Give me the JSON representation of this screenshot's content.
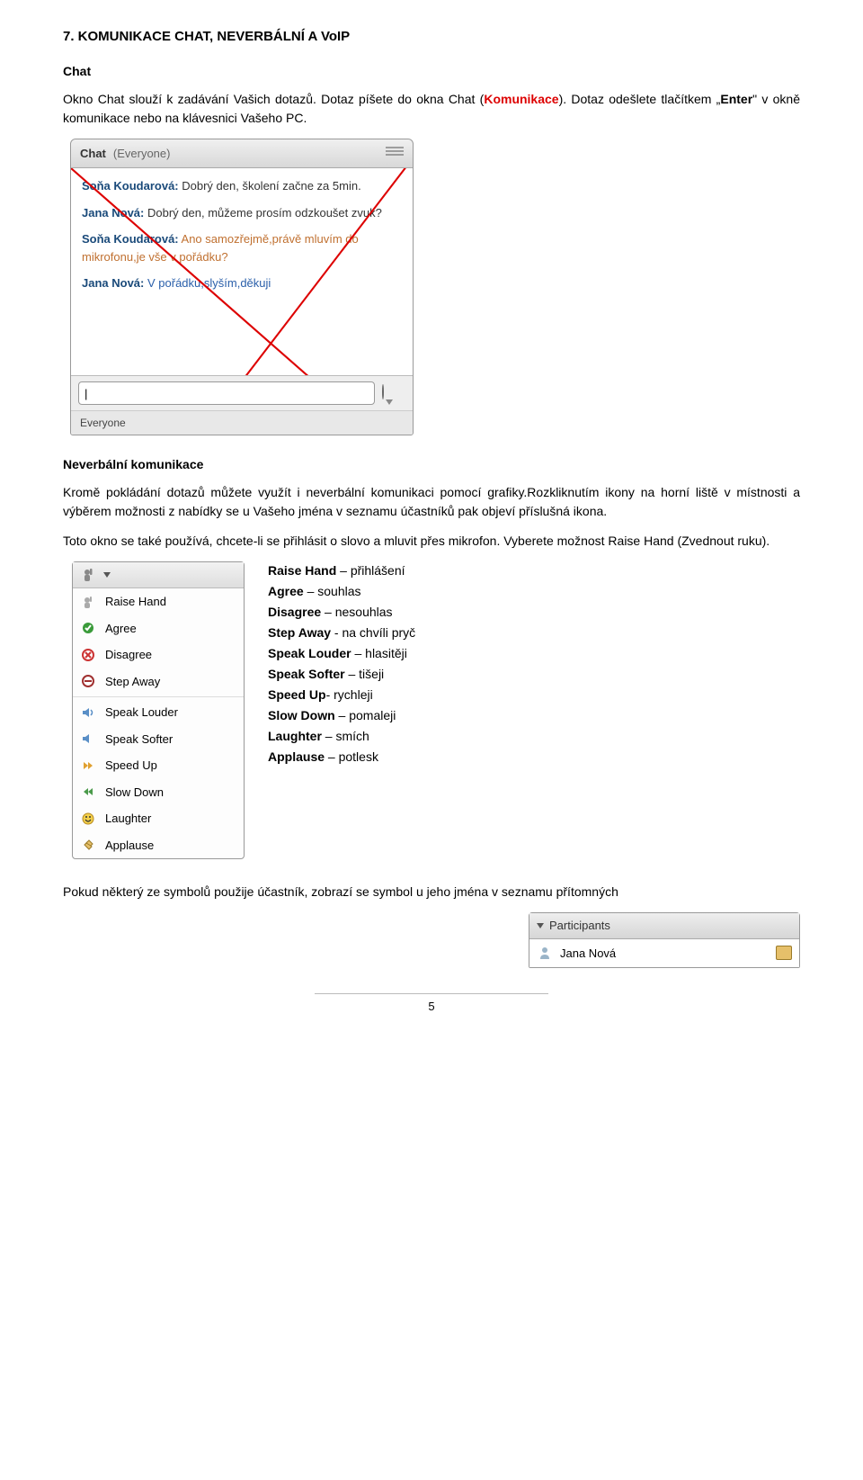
{
  "title": "7.   KOMUNIKACE CHAT, NEVERBÁLNÍ A VoIP",
  "sec1": {
    "heading": "Chat",
    "para1_a": "Okno Chat slouží k zadávání Vašich dotazů. Dotaz píšete do okna Chat (",
    "para1_red": "Komunikace",
    "para1_b": "). Dotaz odešlete tlačítkem „",
    "para1_enter": "Enter",
    "para1_c": "\" v okně komunikace nebo na klávesnici Vašeho PC."
  },
  "chat": {
    "title": "Chat",
    "scope": "(Everyone)",
    "messages": [
      {
        "author": "Soňa Koudarová:",
        "text": "Dobrý den, školení začne za 5min."
      },
      {
        "author": "Jana Nová:",
        "text": "Dobrý den, můžeme prosím odzkoušet zvuk?"
      },
      {
        "author": "Soňa Koudarová:",
        "text": "Ano samozřejmě,právě mluvím do mikrofonu,je vše v pořádku?"
      },
      {
        "author": "Jana Nová:",
        "text": "V pořádku,slyším,děkuji"
      }
    ],
    "input_value": "|",
    "footer": "Everyone"
  },
  "sec2": {
    "heading": "Neverbální komunikace",
    "para1": "Kromě pokládání dotazů můžete využít i neverbální komunikaci pomocí grafiky.Rozkliknutím ikony na horní liště v místnosti  a výběrem možnosti z nabídky se u Vašeho jména v seznamu účastníků pak objeví příslušná ikona.",
    "para2": "Toto okno se také používá, chcete-li se přihlásit o slovo a mluvit přes mikrofon. Vyberete možnost Raise Hand (Zvednout ruku)."
  },
  "rh_menu": {
    "items": [
      "Raise Hand",
      "Agree",
      "Disagree",
      "Step Away",
      "Speak Louder",
      "Speak Softer",
      "Speed Up",
      "Slow Down",
      "Laughter",
      "Applause"
    ]
  },
  "rh_defs": [
    {
      "term": "Raise Hand",
      "def": " – přihlášení"
    },
    {
      "term": "Agree",
      "def": " – souhlas"
    },
    {
      "term": "Disagree",
      "def": " – nesouhlas"
    },
    {
      "term": "Step Away",
      "def": " -  na chvíli pryč"
    },
    {
      "term": "Speak Louder",
      "def": " – hlasitěji"
    },
    {
      "term": "Speak Softer",
      "def": " – tišeji"
    },
    {
      "term": "Speed Up",
      "def": "- rychleji"
    },
    {
      "term": "Slow Down",
      "def": " – pomaleji"
    },
    {
      "term": "Laughter",
      "def": " – smích"
    },
    {
      "term": "Applause",
      "def": " – potlesk"
    }
  ],
  "sec3": {
    "para": "Pokud některý ze symbolů použije účastník, zobrazí se symbol u jeho jména v seznamu přítomných"
  },
  "participants": {
    "title": "Participants",
    "row_name": "Jana Nová"
  },
  "page_num": "5"
}
